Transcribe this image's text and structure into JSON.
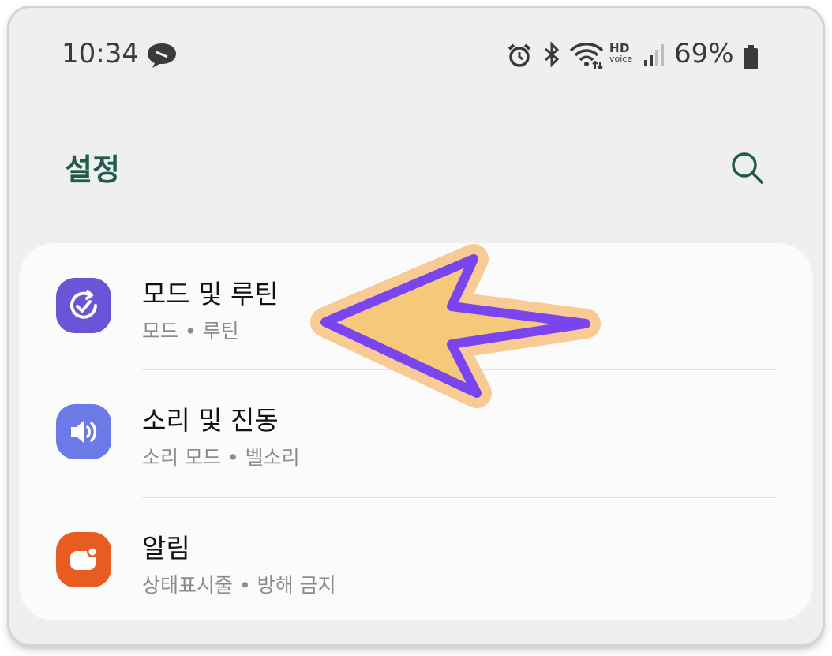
{
  "status_bar": {
    "time": "10:34",
    "hd_label": "HD",
    "voice_label": "voice",
    "battery": "69%"
  },
  "header": {
    "title": "설정"
  },
  "icons": {
    "status": [
      "chat-bubble-icon",
      "alarm-icon",
      "bluetooth-icon",
      "wifi-icon",
      "signal-icon",
      "battery-icon"
    ],
    "header": "search-icon",
    "rows": [
      "modes-routines-icon",
      "sound-icon",
      "notifications-icon"
    ]
  },
  "colors": {
    "title": "#1f5a4c",
    "modes_icon": "#6a55d6",
    "sound_icon": "#6b7ae6",
    "notification_icon": "#e95c21",
    "arrow_fill": "#f6c97a",
    "arrow_stroke": "#7a45ee"
  },
  "settings": [
    {
      "title": "모드 및 루틴",
      "subtitle": "모드  •  루틴"
    },
    {
      "title": "소리 및 진동",
      "subtitle": "소리 모드  •  벨소리"
    },
    {
      "title": "알림",
      "subtitle": "상태표시줄  •  방해 금지"
    }
  ]
}
